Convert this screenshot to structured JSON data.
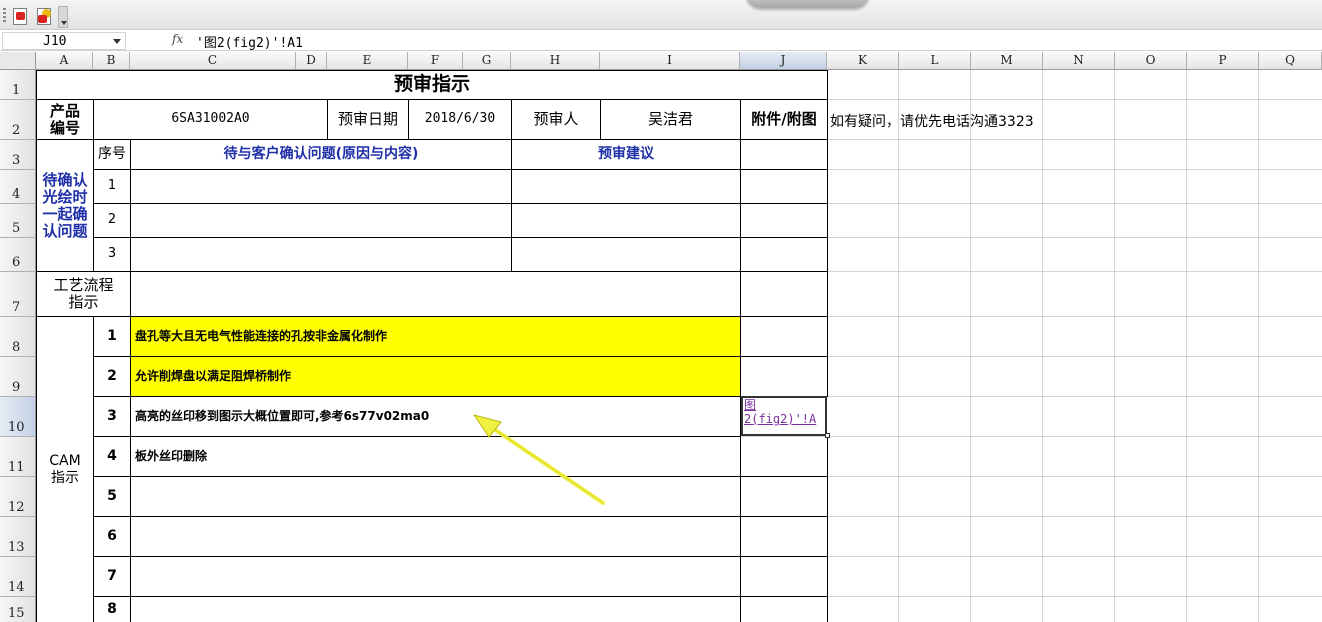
{
  "toolbar": {
    "buttons": [
      {
        "icon": "pdf-export-icon"
      },
      {
        "icon": "pdf-settings-icon"
      }
    ]
  },
  "formula_bar": {
    "name_box": "J10",
    "fx_label": "fx",
    "formula": "'图2(fig2)'!A1"
  },
  "columns": [
    "A",
    "B",
    "C",
    "D",
    "E",
    "F",
    "G",
    "H",
    "I",
    "J",
    "K",
    "L",
    "M",
    "N",
    "O",
    "P",
    "Q"
  ],
  "rows": [
    "1",
    "2",
    "3",
    "4",
    "5",
    "6",
    "7",
    "8",
    "9",
    "10",
    "11",
    "12",
    "13",
    "14",
    "15"
  ],
  "sheet": {
    "title": "预审指示",
    "product_label": "产品\n编号",
    "product_value": "6SA31002A0",
    "review_date_label": "预审日期",
    "review_date_value": "2018/6/30",
    "reviewer_label": "预审人",
    "reviewer_value": "吴洁君",
    "attachment_label": "附件/附图",
    "note": "如有疑问，请优先电话沟通3323",
    "confirm_section_label": "待确认\n光绘时\n一起确\n认问题",
    "seq_header": "序号",
    "issue_header": "待与客户确认问题(原因与内容)",
    "suggestion_header": "预审建议",
    "confirm_rows": [
      "1",
      "2",
      "3"
    ],
    "process_label": "工艺流程\n指示",
    "cam_label": "CAM\n指示",
    "cam_rows": [
      {
        "num": "1",
        "text": "盘孔等大且无电气性能连接的孔按非金属化制作",
        "highlight": true
      },
      {
        "num": "2",
        "text": "允许削焊盘以满足阻焊桥制作",
        "highlight": true
      },
      {
        "num": "3",
        "text": "高亮的丝印移到图示大概位置即可,参考6s77v02ma0",
        "highlight": false
      },
      {
        "num": "4",
        "text": "板外丝印删除",
        "highlight": false
      },
      {
        "num": "5",
        "text": "",
        "highlight": false
      },
      {
        "num": "6",
        "text": "",
        "highlight": false
      },
      {
        "num": "7",
        "text": "",
        "highlight": false
      },
      {
        "num": "8",
        "text": "",
        "highlight": false
      }
    ],
    "hyperlink": "图\n2(fig2)'!A"
  },
  "colors": {
    "highlight": "#ffff00",
    "header_blue": "#1f2fa8",
    "link": "#7b2f9f",
    "arrow": "#f0f040"
  }
}
